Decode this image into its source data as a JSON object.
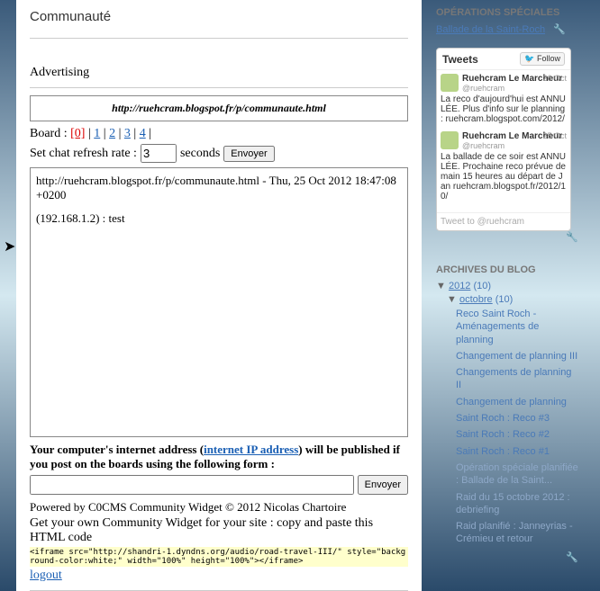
{
  "page": {
    "title": "Communauté",
    "advertising_label": "Advertising",
    "url": "http://ruehcram.blogspot.fr/p/communaute.html",
    "board_label": "Board : ",
    "boards": [
      "[0]",
      "1",
      "2",
      "3",
      "4"
    ],
    "refresh_label": "Set chat refresh rate : ",
    "refresh_value": "3",
    "refresh_seconds": "seconds",
    "send_button": "Envoyer",
    "chat_line1": "http://ruehcram.blogspot.fr/p/communaute.html - Thu, 25 Oct 2012 18:47:08 +0200",
    "chat_line2": "(192.168.1.2) : test",
    "ip_notice_1": "Your computer's internet address (",
    "ip_notice_link": "internet IP address",
    "ip_notice_2": ") will be published if you post on the boards using the following form :",
    "post_button": "Envoyer",
    "powered": "Powered by C0CMS Community Widget © 2012 Nicolas Chartoire",
    "get_own": "Get your own Community Widget for your site : copy and paste this HTML code",
    "iframe_code": "<iframe src=\"http://shandri-1.dyndns.org/audio/road-travel-III/\" style=\"background-color:white;\" width=\"100%\" height=\"100%\"></iframe>",
    "logout": "logout"
  },
  "sidebar": {
    "operations_heading": "OPÉRATIONS SPÉCIALES",
    "operations_link": "Ballade de la Saint-Roch",
    "tweets_heading": "Tweets",
    "follow_label": "Follow",
    "tweets": [
      {
        "name": "Ruehcram Le Marcheur",
        "handle": "@ruehcram",
        "date": "26 Oct",
        "text": "La reco d'aujourd'hui est ANNULÉE. Plus d'info sur le planning : ruehcram.blogspot.com/2012/"
      },
      {
        "name": "Ruehcram Le Marcheur",
        "handle": "@ruehcram",
        "date": "25 Oct",
        "text": "La ballade de ce soir est ANNULÉE. Prochaine reco prévue demain 15 heures au départ de Jan ruehcram.blogspot.fr/2012/10/"
      }
    ],
    "tweet_compose": "Tweet to @ruehcram",
    "archives_heading": "ARCHIVES DU BLOG",
    "year": "2012",
    "year_count": "(10)",
    "month": "octobre",
    "month_count": "(10)",
    "posts": [
      "Reco Saint Roch - Aménagements de planning",
      "Changement de planning III",
      "Changements de planning II",
      "Changement de planning",
      "Saint Roch : Reco #3",
      "Saint Roch : Reco #2",
      "Saint Roch : Reco #1",
      "Opération spéciale planifiée : Ballade de la Saint...",
      "Raid du 15 octobre 2012 : debriefing",
      "Raid planifié : Janneyrias - Crémieu et retour"
    ]
  }
}
